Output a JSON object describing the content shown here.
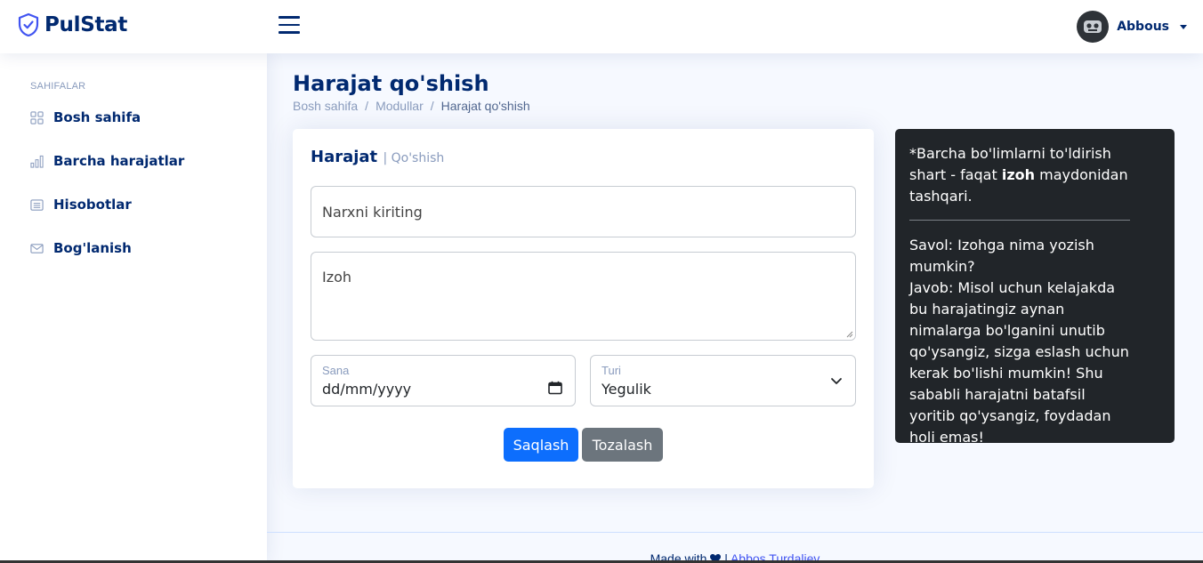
{
  "brand": {
    "name": "PulStat",
    "icon": "shield-check-icon"
  },
  "header": {
    "menu_icon": "hamburger-icon",
    "user_name": "Abbous"
  },
  "sidebar": {
    "heading": "SAHIFALAR",
    "items": [
      {
        "label": "Bosh sahifa",
        "icon": "grid-icon"
      },
      {
        "label": "Barcha harajatlar",
        "icon": "bar-chart-icon"
      },
      {
        "label": "Hisobotlar",
        "icon": "list-card-icon"
      },
      {
        "label": "Bog'lanish",
        "icon": "envelope-icon"
      }
    ]
  },
  "page": {
    "title": "Harajat qo'shish",
    "breadcrumb": [
      "Bosh sahifa",
      "Modullar",
      "Harajat qo'shish"
    ]
  },
  "form": {
    "title": "Harajat",
    "subtitle": "| Qo'shish",
    "price_placeholder": "Narxni kiriting",
    "note_placeholder": "Izoh",
    "date_label": "Sana",
    "date_value": "dd/mm/yyyy",
    "type_label": "Turi",
    "type_value": "Yegulik",
    "save_label": "Saqlash",
    "clear_label": "Tozalash"
  },
  "info": {
    "line1_a": "*Barcha bo'limlarni to'ldirish shart - faqat ",
    "line1_bold": "izoh",
    "line1_b": " maydonidan tashqari.",
    "question": "Savol: Izohga nima yozish mumkin?",
    "answer": "Javob: Misol uchun kelajakda bu harajatingiz aynan nimalarga bo'lganini unutib qo'ysangiz, sizga eslash uchun kerak bo'lishi mumkin! Shu sababli harajatni batafsil yoritib qo'ysangiz, foydadan holi emas!"
  },
  "footer": {
    "made_with": "Made with",
    "heart_icon": "heart-icon",
    "separator": "|",
    "author": "Abbos Turdaliev"
  },
  "colors": {
    "brand": "#012970",
    "primary": "#0d6efd",
    "secondary": "#6c757d",
    "info_bg": "#212529"
  }
}
